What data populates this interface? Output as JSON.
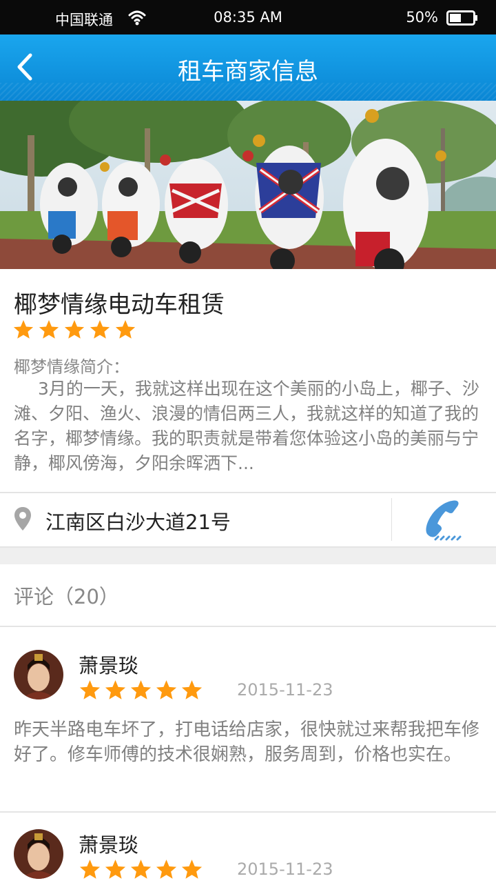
{
  "status_bar": {
    "carrier": "中国联通",
    "time": "08:35 AM",
    "battery": "50%"
  },
  "nav": {
    "title": "租车商家信息",
    "back_icon": "chevron-left-icon"
  },
  "colors": {
    "nav_blue": "#0f95e0",
    "star_orange": "#ff9a0f",
    "phone_blue": "#3e92d8"
  },
  "shop": {
    "name": "椰梦情缘电动车租赁",
    "rating": 5,
    "intro_label": "椰梦情缘简介：",
    "intro_text": "3月的一天，我就这样出现在这个美丽的小岛上，椰子、沙滩、夕阳、渔火、浪漫的情侣两三人，我就这样的知道了我的名字，椰梦情缘。我的职责就是带着您体验这小岛的美丽与宁静，椰风傍海，夕阳余晖洒下...",
    "address": "江南区白沙大道21号"
  },
  "comments_header": "评论（20）",
  "comments": [
    {
      "user": "萧景琰",
      "rating": 5,
      "date": "2015-11-23",
      "text": "昨天半路电车坏了，打电话给店家，很快就过来帮我把车修好了。修车师傅的技术很娴熟，服务周到，价格也实在。"
    },
    {
      "user": "萧景琰",
      "rating": 5,
      "date": "2015-11-23",
      "text": ""
    }
  ]
}
